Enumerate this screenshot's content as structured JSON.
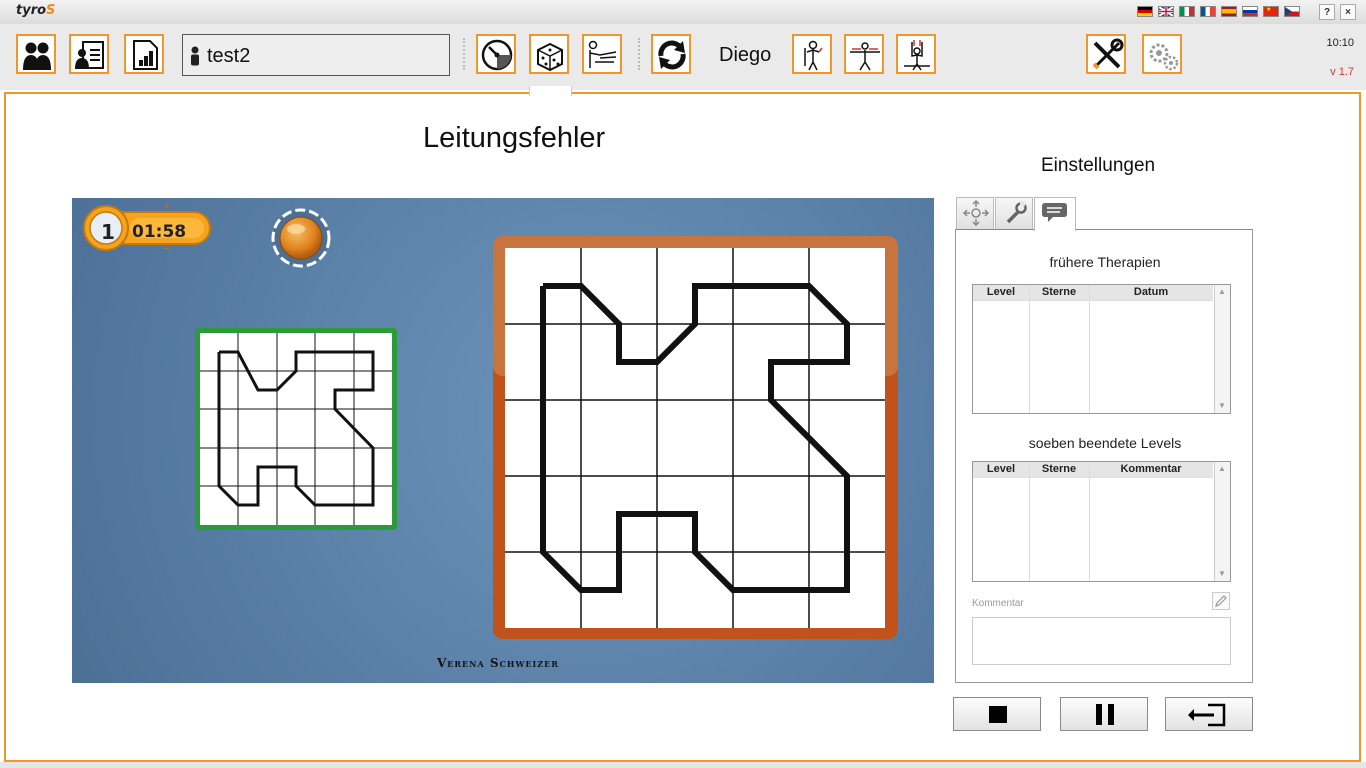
{
  "app": {
    "logo_main": "tyro",
    "logo_accent": "S",
    "clock": "10:10",
    "version": "v 1.7"
  },
  "window_buttons": {
    "help": "?",
    "close": "×"
  },
  "languages": [
    "german-flag",
    "uk-flag",
    "italy-flag",
    "france-flag",
    "spain-flag",
    "russia-flag",
    "china-flag",
    "czech-flag"
  ],
  "toolbar": {
    "patient": "test2",
    "therapist": "Diego"
  },
  "game": {
    "title": "Leitungsfehler",
    "level": "1",
    "timer": "01:58",
    "author": "Verena Schweizer",
    "colors": {
      "background": "#5e84ab",
      "sample_frame": "#2c9a3a",
      "target_frame": "#c0521a",
      "timer_badge": "#f7a31c"
    }
  },
  "settings": {
    "title": "Einstellungen",
    "previous_therapies": {
      "title": "frühere Therapien",
      "columns": [
        "Level",
        "Sterne",
        "Datum"
      ]
    },
    "finished_levels": {
      "title": "soeben beendete Levels",
      "columns": [
        "Level",
        "Sterne",
        "Kommentar"
      ]
    },
    "comment_label": "Kommentar"
  },
  "accent_color": "#f0962a"
}
